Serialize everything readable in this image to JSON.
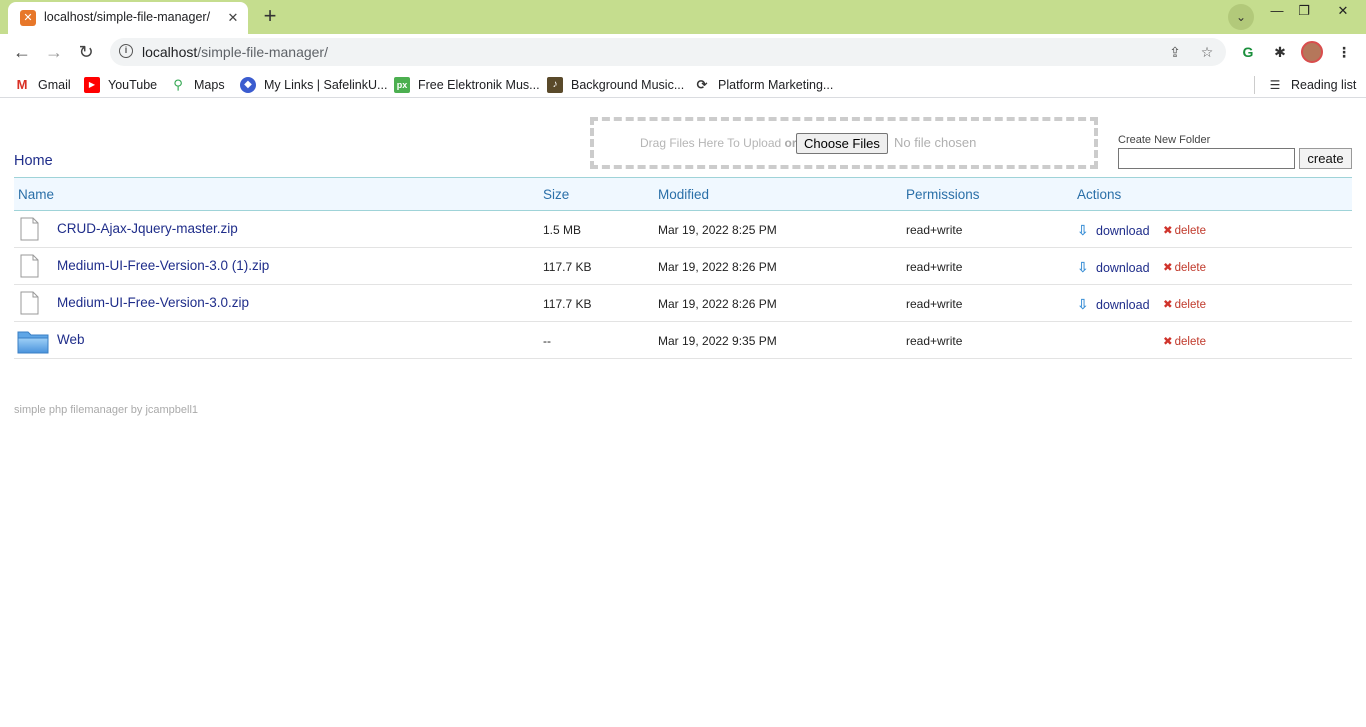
{
  "browser": {
    "tab_title": "localhost/simple-file-manager/",
    "url_host": "localhost",
    "url_path": "/simple-file-manager/",
    "bookmarks": [
      {
        "label": "Gmail",
        "icon": "gmail-icon",
        "color": "#d93025"
      },
      {
        "label": "YouTube",
        "icon": "youtube-icon",
        "color": "#ff0000"
      },
      {
        "label": "Maps",
        "icon": "maps-icon",
        "color": "#34a853"
      },
      {
        "label": "My Links | SafelinkU...",
        "icon": "safelink-icon",
        "color": "#3b5ccf"
      },
      {
        "label": "Free Elektronik Mus...",
        "icon": "px-icon",
        "color": "#4caf50"
      },
      {
        "label": "Background Music...",
        "icon": "music-icon",
        "color": "#5a4a2a"
      },
      {
        "label": "Platform Marketing...",
        "icon": "platform-icon",
        "color": "#444444"
      }
    ],
    "reading_list": "Reading list"
  },
  "page": {
    "breadcrumb": "Home",
    "upload": {
      "drag_text": "Drag Files Here To Upload",
      "or_text": "or",
      "choose_label": "Choose Files",
      "no_file": "No file chosen"
    },
    "new_folder": {
      "label": "Create New Folder",
      "value": "",
      "button": "create"
    },
    "columns": [
      "Name",
      "Size",
      "Modified",
      "Permissions",
      "Actions"
    ],
    "rows": [
      {
        "name": "CRUD-Ajax-Jquery-master.zip",
        "type": "file",
        "size": "1.5 MB",
        "modified": "Mar 19, 2022 8:25 PM",
        "permissions": "read+write",
        "download": "download",
        "delete": "delete"
      },
      {
        "name": "Medium-UI-Free-Version-3.0 (1).zip",
        "type": "file",
        "size": "117.7 KB",
        "modified": "Mar 19, 2022 8:26 PM",
        "permissions": "read+write",
        "download": "download",
        "delete": "delete"
      },
      {
        "name": "Medium-UI-Free-Version-3.0.zip",
        "type": "file",
        "size": "117.7 KB",
        "modified": "Mar 19, 2022 8:26 PM",
        "permissions": "read+write",
        "download": "download",
        "delete": "delete"
      },
      {
        "name": "Web",
        "type": "folder",
        "size": "--",
        "modified": "Mar 19, 2022 9:35 PM",
        "permissions": "read+write",
        "download": "",
        "delete": "delete"
      }
    ],
    "footer": "simple php filemanager by jcampbell1"
  },
  "colors": {
    "link": "#1f2d8a",
    "header_text": "#2a6fa8",
    "delete": "#c0392b",
    "tabbar": "#c5dd8e"
  }
}
